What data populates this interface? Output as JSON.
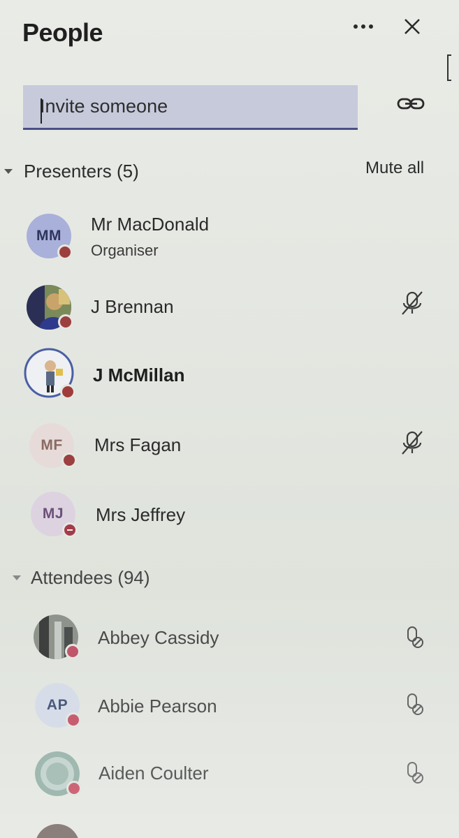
{
  "header": {
    "title": "People"
  },
  "invite": {
    "placeholder": "Invite someone"
  },
  "presenters": {
    "label": "Presenters (5)",
    "mute_all": "Mute all",
    "people": [
      {
        "initials": "MM",
        "name": "Mr MacDonald",
        "role": "Organiser",
        "avatar": "initials",
        "mic": "none"
      },
      {
        "initials": "",
        "name": "J Brennan",
        "avatar": "photo",
        "mic": "muted-mic-icon"
      },
      {
        "initials": "",
        "name": "J McMillan",
        "avatar": "photo",
        "mic": "none",
        "speaking": true
      },
      {
        "initials": "MF",
        "name": "Mrs Fagan",
        "avatar": "initials",
        "mic": "muted-mic-icon"
      },
      {
        "initials": "MJ",
        "name": "Mrs Jeffrey",
        "avatar": "initials",
        "mic": "none",
        "status": "do-not-disturb"
      }
    ]
  },
  "attendees": {
    "label": "Attendees (94)",
    "people": [
      {
        "initials": "",
        "name": "Abbey Cassidy",
        "avatar": "photo",
        "mic": "mic-off-icon"
      },
      {
        "initials": "AP",
        "name": "Abbie Pearson",
        "avatar": "initials",
        "mic": "mic-off-icon"
      },
      {
        "initials": "",
        "name": "Aiden Coulter",
        "avatar": "photo",
        "mic": "mic-off-icon"
      }
    ]
  },
  "colors": {
    "accent": "#4a4f86",
    "status_busy": "#a14a4a",
    "avatar_bg": "#c7cbe0"
  }
}
